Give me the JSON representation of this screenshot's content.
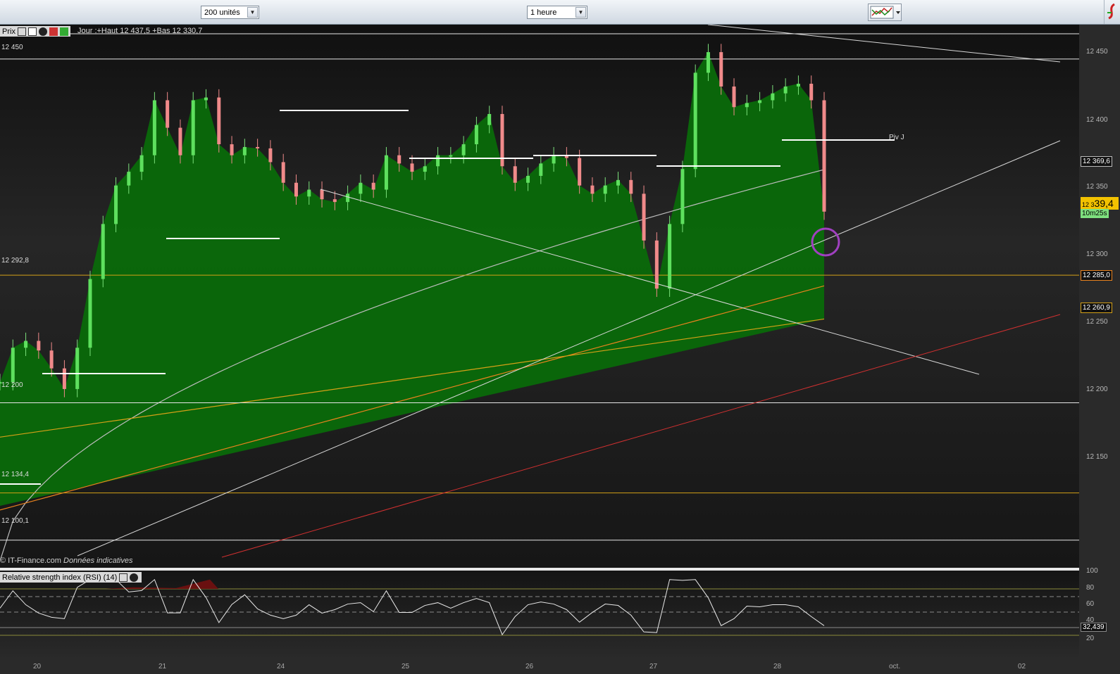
{
  "toolbar": {
    "units_select": "200 unités",
    "period_select": "1 heure"
  },
  "price_panel": {
    "tab_label": "Prix",
    "legend": "Jour :+Haut 12 437,5 +Bas 12 330,7",
    "levels": [
      "12 450",
      "12 292,8",
      "12 200",
      "12 134,4",
      "12 100,1"
    ],
    "pivot_label": "Piv J",
    "copyright": "© IT-Finance.com",
    "disclaimer": "Données indicatives"
  },
  "price_axis": {
    "ticks": [
      "12 450",
      "12 400",
      "12 369,6",
      "12 350",
      "12 300",
      "12 285,0",
      "12 260,9",
      "12 250",
      "12 200",
      "12 150"
    ],
    "current_price_prefix": "12 3",
    "current_price_big": "39,4",
    "countdown": "10m25s",
    "colors": {
      "ma_short": "#ffffff",
      "ma_mid": "#e8821e",
      "ma_long": "#d4a017",
      "current": "#f2c200",
      "countdown_bg": "#7ee07e"
    }
  },
  "rsi_panel": {
    "title": "Relative strength index (RSI) (14)",
    "ticks": [
      "100",
      "80",
      "60",
      "40",
      "20"
    ],
    "current_value": "32,439"
  },
  "time_axis": {
    "dates": [
      "20",
      "21",
      "24",
      "25",
      "26",
      "27",
      "28",
      "oct.",
      "02"
    ]
  },
  "chart_data": {
    "type": "candlestick",
    "title": "",
    "ylim": [
      12080,
      12475
    ],
    "x_categories": [
      "20",
      "21",
      "24",
      "25",
      "26",
      "27",
      "28",
      "oct.",
      "02"
    ],
    "close_series": [
      12215,
      12240,
      12245,
      12238,
      12225,
      12210,
      12240,
      12290,
      12330,
      12358,
      12368,
      12380,
      12420,
      12400,
      12380,
      12420,
      12422,
      12388,
      12380,
      12386,
      12385,
      12375,
      12360,
      12350,
      12355,
      12348,
      12346,
      12352,
      12360,
      12355,
      12380,
      12374,
      12368,
      12372,
      12380,
      12380,
      12388,
      12402,
      12410,
      12372,
      12360,
      12365,
      12374,
      12380,
      12378,
      12358,
      12352,
      12358,
      12362,
      12352,
      12318,
      12283,
      12330,
      12370,
      12440,
      12455,
      12430,
      12415,
      12418,
      12420,
      12425,
      12430,
      12432,
      12420,
      12339
    ],
    "current_price": 12339.4,
    "day_high": 12437.5,
    "day_low": 12330.7,
    "horizontal_levels": [
      12450,
      12292.8,
      12200,
      12134.4,
      12100.1
    ],
    "ma_values_last": {
      "white": 12369.6,
      "orange": 12285.0,
      "gold": 12260.9
    },
    "rsi": {
      "ylim": [
        0,
        100
      ],
      "last": 32.439,
      "levels": [
        80,
        70,
        50,
        30,
        20
      ]
    }
  }
}
